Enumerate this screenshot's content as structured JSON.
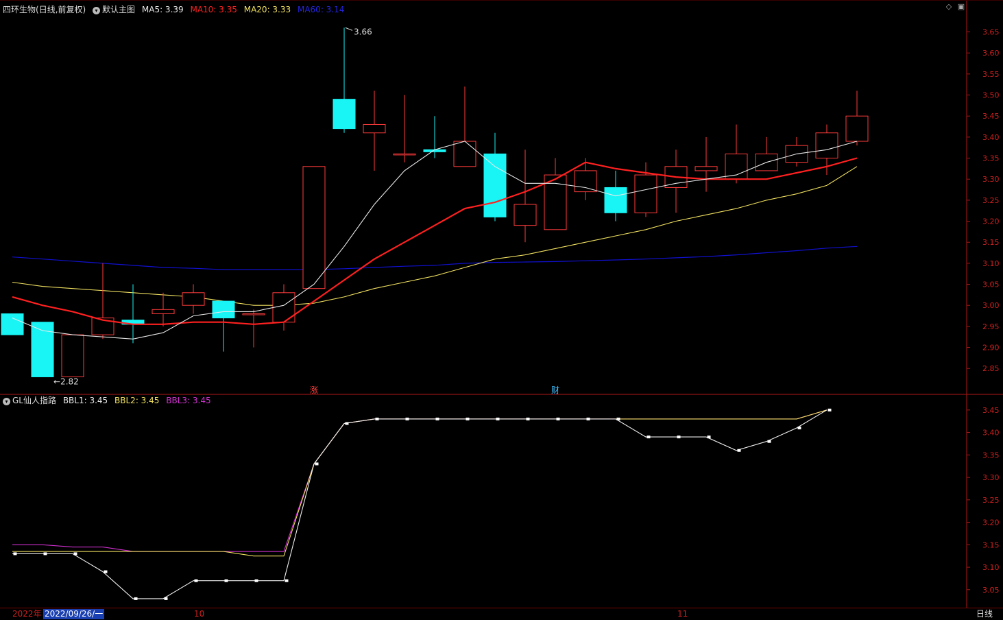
{
  "header": {
    "stock_name": "四环生物",
    "period": "(日线,前复权)",
    "template": "默认主图",
    "ma5": "MA5: 3.39",
    "ma10": "MA10: 3.35",
    "ma20": "MA20: 3.33",
    "ma60": "MA60: 3.14"
  },
  "indicator_header": {
    "name": "GL仙人指路",
    "bbl1": "BBL1: 3.45",
    "bbl2": "BBL2: 3.45",
    "bbl3": "BBL3: 3.45"
  },
  "markers": {
    "high": "3.66",
    "low": "2.82",
    "event1": "涨",
    "event2": "财"
  },
  "datebar": {
    "year": "2022年",
    "cursor_date": "2022/09/26/一",
    "oct": "10",
    "nov": "11",
    "period_btn": "日线"
  },
  "colors": {
    "up": "#ff3b3b",
    "down": "#19f5f5",
    "ma5": "#e8e8e8",
    "ma10": "#ff2020",
    "ma20": "#f0e060",
    "ma60": "#1010d0",
    "bbl3": "#d030d0",
    "axis": "#b01818"
  },
  "chart_data": [
    {
      "type": "candlestick",
      "main_axis_ticks": [
        "3.65",
        "3.60",
        "3.55",
        "3.50",
        "3.45",
        "3.40",
        "3.35",
        "3.30",
        "3.25",
        "3.20",
        "3.15",
        "3.10",
        "3.05",
        "3.00",
        "2.95",
        "2.90",
        "2.85"
      ],
      "ylim": [
        2.79,
        3.69
      ],
      "candles": [
        {
          "o": 2.98,
          "h": 2.98,
          "l": 2.93,
          "c": 2.93
        },
        {
          "o": 2.96,
          "h": 2.96,
          "l": 2.83,
          "c": 2.83
        },
        {
          "o": 2.83,
          "h": 2.93,
          "l": 2.83,
          "c": 2.93
        },
        {
          "o": 2.93,
          "h": 3.1,
          "l": 2.92,
          "c": 2.97
        },
        {
          "o": 2.965,
          "h": 3.05,
          "l": 2.91,
          "c": 2.955
        },
        {
          "o": 2.98,
          "h": 3.03,
          "l": 2.95,
          "c": 2.99
        },
        {
          "o": 3.0,
          "h": 3.05,
          "l": 2.98,
          "c": 3.03
        },
        {
          "o": 3.01,
          "h": 3.01,
          "l": 2.89,
          "c": 2.97
        },
        {
          "o": 2.98,
          "h": 2.99,
          "l": 2.9,
          "c": 2.98
        },
        {
          "o": 2.96,
          "h": 3.05,
          "l": 2.94,
          "c": 3.03
        },
        {
          "o": 3.04,
          "h": 3.33,
          "l": 3.04,
          "c": 3.33
        },
        {
          "o": 3.49,
          "h": 3.66,
          "l": 3.41,
          "c": 3.42
        },
        {
          "o": 3.41,
          "h": 3.51,
          "l": 3.32,
          "c": 3.43
        },
        {
          "o": 3.36,
          "h": 3.5,
          "l": 3.34,
          "c": 3.36
        },
        {
          "o": 3.37,
          "h": 3.45,
          "l": 3.35,
          "c": 3.365
        },
        {
          "o": 3.33,
          "h": 3.52,
          "l": 3.33,
          "c": 3.39
        },
        {
          "o": 3.36,
          "h": 3.41,
          "l": 3.2,
          "c": 3.21
        },
        {
          "o": 3.19,
          "h": 3.37,
          "l": 3.15,
          "c": 3.24
        },
        {
          "o": 3.18,
          "h": 3.35,
          "l": 3.18,
          "c": 3.31
        },
        {
          "o": 3.27,
          "h": 3.35,
          "l": 3.25,
          "c": 3.32
        },
        {
          "o": 3.28,
          "h": 3.32,
          "l": 3.2,
          "c": 3.22
        },
        {
          "o": 3.22,
          "h": 3.34,
          "l": 3.21,
          "c": 3.31
        },
        {
          "o": 3.28,
          "h": 3.37,
          "l": 3.22,
          "c": 3.33
        },
        {
          "o": 3.32,
          "h": 3.4,
          "l": 3.27,
          "c": 3.33
        },
        {
          "o": 3.3,
          "h": 3.43,
          "l": 3.29,
          "c": 3.36
        },
        {
          "o": 3.32,
          "h": 3.4,
          "l": 3.32,
          "c": 3.36
        },
        {
          "o": 3.34,
          "h": 3.4,
          "l": 3.33,
          "c": 3.38
        },
        {
          "o": 3.35,
          "h": 3.43,
          "l": 3.31,
          "c": 3.41
        },
        {
          "o": 3.39,
          "h": 3.51,
          "l": 3.38,
          "c": 3.45
        }
      ],
      "ma5": [
        2.97,
        2.94,
        2.93,
        2.925,
        2.92,
        2.935,
        2.975,
        2.985,
        2.985,
        3.0,
        3.05,
        3.14,
        3.24,
        3.32,
        3.37,
        3.39,
        3.33,
        3.29,
        3.29,
        3.28,
        3.26,
        3.275,
        3.29,
        3.3,
        3.31,
        3.34,
        3.36,
        3.37,
        3.39
      ],
      "ma10": [
        3.02,
        3.0,
        2.985,
        2.965,
        2.955,
        2.955,
        2.96,
        2.96,
        2.955,
        2.96,
        3.01,
        3.06,
        3.11,
        3.15,
        3.19,
        3.23,
        3.245,
        3.27,
        3.3,
        3.34,
        3.325,
        3.315,
        3.305,
        3.3,
        3.3,
        3.3,
        3.315,
        3.33,
        3.35
      ],
      "ma20": [
        3.055,
        3.045,
        3.04,
        3.035,
        3.03,
        3.025,
        3.02,
        3.01,
        3.0,
        3.0,
        3.005,
        3.02,
        3.04,
        3.055,
        3.07,
        3.09,
        3.11,
        3.12,
        3.135,
        3.15,
        3.165,
        3.18,
        3.2,
        3.215,
        3.23,
        3.25,
        3.265,
        3.285,
        3.33
      ],
      "ma60": [
        3.115,
        3.11,
        3.105,
        3.1,
        3.095,
        3.09,
        3.088,
        3.085,
        3.085,
        3.085,
        3.085,
        3.087,
        3.09,
        3.093,
        3.095,
        3.1,
        3.102,
        3.103,
        3.104,
        3.106,
        3.108,
        3.11,
        3.113,
        3.116,
        3.12,
        3.125,
        3.13,
        3.136,
        3.14
      ]
    },
    {
      "type": "line",
      "title": "GL仙人指路",
      "sub_axis_ticks": [
        "3.45",
        "3.40",
        "3.35",
        "3.30",
        "3.25",
        "3.20",
        "3.15",
        "3.10",
        "3.05"
      ],
      "ylim": [
        3.01,
        3.465
      ],
      "series": [
        {
          "name": "BBL1",
          "values": [
            3.13,
            3.13,
            3.13,
            3.09,
            3.03,
            3.03,
            3.07,
            3.07,
            3.07,
            3.07,
            3.33,
            3.42,
            3.43,
            3.43,
            3.43,
            3.43,
            3.43,
            3.43,
            3.43,
            3.43,
            3.43,
            3.39,
            3.39,
            3.39,
            3.36,
            3.38,
            3.41,
            3.45
          ]
        },
        {
          "name": "BBL2",
          "values": [
            3.135,
            3.135,
            3.135,
            3.135,
            3.135,
            3.135,
            3.135,
            3.135,
            3.125,
            3.125,
            3.33,
            3.42,
            3.43,
            3.43,
            3.43,
            3.43,
            3.43,
            3.43,
            3.43,
            3.43,
            3.43,
            3.43,
            3.43,
            3.43,
            3.43,
            3.43,
            3.43,
            3.45
          ]
        },
        {
          "name": "BBL3",
          "values": [
            3.15,
            3.15,
            3.145,
            3.145,
            3.135,
            3.135,
            3.135,
            3.135,
            3.135,
            3.135,
            3.33,
            3.42,
            3.43,
            3.43,
            3.43,
            3.43,
            3.43,
            3.43,
            3.43,
            3.43,
            3.43,
            3.43,
            3.43,
            3.43,
            3.43,
            3.43,
            3.43,
            3.45
          ]
        }
      ]
    }
  ]
}
